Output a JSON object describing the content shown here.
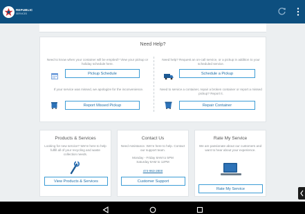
{
  "app": {
    "brand_line1": "REPUBLIC",
    "brand_line2": "SERVICES"
  },
  "help": {
    "title": "Need Help?",
    "pickup_schedule": {
      "desc": "Need to know when your container will be emptied? View your pickup or holiday schedule here.",
      "button": "Pickup Schedule"
    },
    "schedule_pickup": {
      "desc": "Need help? Request an on-call service, or a pickup in addition to your scheduled service.",
      "button": "Schedule a Pickup"
    },
    "missed_pickup": {
      "desc": "If your service was missed, we apologize for the inconvenience.",
      "button": "Report Missed Pickup"
    },
    "repair_container": {
      "desc": "Need to service a container, repair a broken container or report a missed pickup? Report it.",
      "button": "Repair Container"
    }
  },
  "products": {
    "title": "Products & Services",
    "desc": "Looking for new service? We're here to help fulfill all of your recycling and waste collection needs.",
    "button": "View Products & Services"
  },
  "contact": {
    "title": "Contact Us",
    "desc": "Need Assistance. We're here to help. Contact our support team.",
    "hours_weekday": "Monday - Friday 8AM to 5PM",
    "hours_saturday": "Saturday 8AM to 12PM",
    "phone": "474-963-2800",
    "button": "Customer Support"
  },
  "rate": {
    "title": "Rate My Service",
    "desc": "We are passionate about our customers and want to hear about your experience.",
    "button": "Rate My Service"
  },
  "colors": {
    "appbar": "#0d4f7f",
    "accent": "#3a9bd5",
    "icon_blue": "#2e73b8"
  },
  "icons": [
    "logo-star-icon",
    "refresh-icon",
    "overflow-menu-icon",
    "calendar-icon",
    "truck-icon",
    "cart-icon",
    "container-icon",
    "wrench-icon",
    "tablet-icon",
    "back-icon",
    "home-icon",
    "recents-icon"
  ]
}
